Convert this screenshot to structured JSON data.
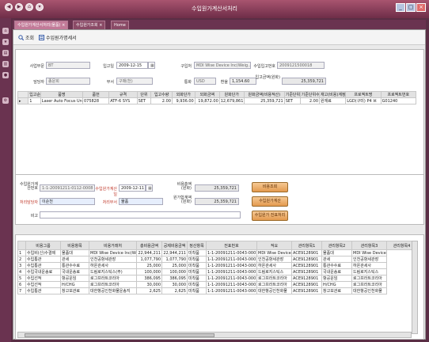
{
  "window": {
    "title": "수입원가계산서처리",
    "controls": {
      "minimize": "_",
      "maximize": "▢",
      "close": "×"
    }
  },
  "tabs": [
    {
      "label": "수입원가계산서처리(물품)"
    },
    {
      "label": "수입원가조회"
    },
    {
      "label": "Home"
    }
  ],
  "toolbar": {
    "search": "조회",
    "print": "수입원가명세서"
  },
  "header": {
    "company_label": "사업부문",
    "company_value": "BT",
    "date_label": "입고일",
    "date_value": "2009-12-15",
    "supplier_label": "구입처",
    "supplier_value": "MDI Wise Device Inc(Weig..",
    "contract_label": "수입입고번호",
    "contract_value": "2009121500018",
    "manager_label": "담당자",
    "manager_value": "종문희",
    "dept_label": "부서",
    "dept_value": "구매(천)",
    "currency_label": "통화",
    "currency_value": "USD",
    "rate_label": "환율",
    "rate_value": "1,154.60",
    "amount_label": "입고금액(원화)",
    "amount_value": "25,359,721"
  },
  "item_table": {
    "headers": [
      "입고순번",
      "품명",
      "품번",
      "규격",
      "단위",
      "입고수량",
      "외화단가",
      "외화금액",
      "원화단가",
      "원화금액(비용적산)",
      "기준단위",
      "기준단위수량",
      "재고(비용)계정",
      "프로젝트명",
      "프로젝트번호"
    ],
    "rows": [
      [
        "1",
        "Laser Auto Focus Unit",
        "075828",
        "ATF-6 SYS",
        "SET",
        "2.00",
        "9,936.00",
        "19,872.00",
        "12,679,861",
        "25,359,721",
        "SET",
        "2.00",
        "원재료",
        "LGD(구미) P4 브",
        "G01240"
      ]
    ]
  },
  "cost_form": {
    "no_label": "수입원가계산번호",
    "no_value": "1-1-20091211-0112-0008",
    "date_label": "수입원가계산일",
    "date_value": "2009-12-11",
    "manager_label": "처리담당자",
    "manager_value": "이순천",
    "dept_label": "처리부서",
    "dept_value": "물품",
    "note_label": "비고",
    "note_value": "",
    "cost_label": "비용총액(원화)",
    "cost_value": "25,359,721",
    "total_label": "원가합계액(원화)",
    "total_value": "25,359,721",
    "btn_cost": "비용조회",
    "btn_calc": "수입원가계산",
    "btn_slip": "수입원가 전표처리"
  },
  "cost_table": {
    "headers": [
      "비용그룹",
      "비용항목",
      "비용거래처",
      "총비용금액",
      "공제비용금액",
      "정산항목",
      "전표번호",
      "적요",
      "관리항목1",
      "관리항목2",
      "관리항목3",
      "관리항목4"
    ],
    "rows": [
      [
        "1",
        "수입비(신)수결제",
        "물품대",
        "MDI Wise Device Inc(Weig",
        "22,944,211",
        "22,944,211",
        "미착품",
        "1-1-20091211-0043-0001",
        "MDI Wise Device",
        "ACE9128901",
        "물품대",
        "MDI Wise Device"
      ],
      [
        "2",
        "수입통관",
        "관세",
        "인천공항세관장",
        "1,077,790",
        "1,077,790",
        "미착품",
        "1-1-20091211-0043-0001",
        "인천공항세관장",
        "ACE9128901",
        "관세",
        "인천공항세관장"
      ],
      [
        "3",
        "수입통관",
        "통관수수료",
        "하온관세사",
        "25,000",
        "25,000",
        "미착품",
        "1-1-20091211-0043-0001",
        "하온관세사",
        "ACE9128901",
        "통관수수료",
        "하온관세사"
      ],
      [
        "4",
        "수입국내운송료",
        "국내운송료",
        "드림로지스틱스(주)",
        "100,000",
        "100,000",
        "미착품",
        "1-1-20091211-0043-0001",
        "드림로지스틱스",
        "ACE9128901",
        "국내운송료",
        "드림로지스틱스"
      ],
      [
        "5",
        "수입선적",
        "항공운임",
        "로그프라트코리아",
        "386,095",
        "386,095",
        "미착품",
        "1-1-20091211-0043-0001",
        "로그프라트코리아",
        "ACE9128901",
        "항공운임",
        "로그프라트코리아"
      ],
      [
        "6",
        "수입선적",
        "H/CHG",
        "로그프라트코리아",
        "30,000",
        "30,000",
        "미착품",
        "1-1-20091211-0043-0001",
        "로그프라트코리아",
        "ACE9128901",
        "H/CHG",
        "로그프라트코리아"
      ],
      [
        "7",
        "수입통관",
        "창고보관료",
        "대한항공인천화물운송지",
        "2,625",
        "2,625",
        "미착품",
        "1-1-20091211-0043-0001",
        "대한항공인천화물",
        "ACE9128901",
        "창고보관료",
        "대한항공인천화물"
      ]
    ]
  }
}
